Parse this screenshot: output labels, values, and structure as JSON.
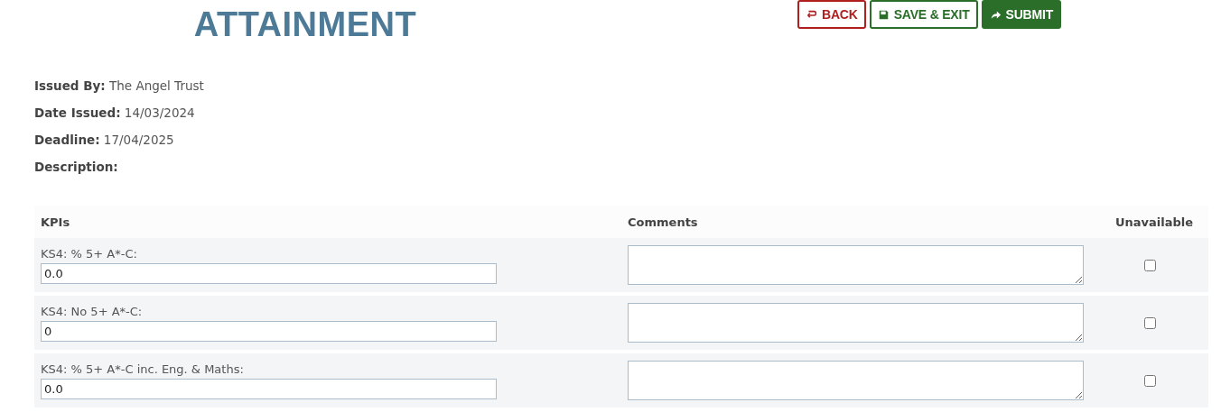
{
  "title": "ATTAINMENT",
  "buttons": [
    {
      "label": "BACK",
      "kind": "back"
    },
    {
      "label": "SAVE & EXIT",
      "kind": "save"
    },
    {
      "label": "SUBMIT",
      "kind": "submit"
    }
  ],
  "details": [
    {
      "label": "Issued By:",
      "value": "The Angel Trust"
    },
    {
      "label": "Date Issued:",
      "value": "14/03/2024"
    },
    {
      "label": "Deadline:",
      "value": "17/04/2025"
    },
    {
      "label": "Description:"
    }
  ],
  "table": {
    "columns": [
      "KPIs",
      "Comments",
      "Unavailable"
    ],
    "rows": [
      {
        "kpi": "KS4: % 5+ A*-C:",
        "value": "0.0",
        "unavailable": false
      },
      {
        "kpi": "KS4: No 5+ A*-C:",
        "value": "0",
        "unavailable": false
      },
      {
        "kpi": "KS4: % 5+ A*-C inc. Eng. & Maths:",
        "value": "0.0",
        "unavailable": false
      }
    ]
  }
}
